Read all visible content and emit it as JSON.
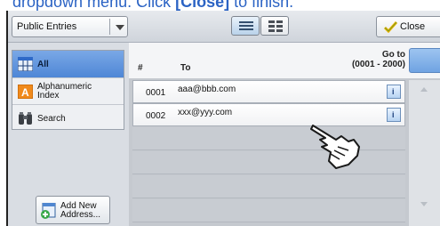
{
  "caption": {
    "prefix": "dropdown menu. Click ",
    "bold": "[Close]",
    "suffix": " to finish."
  },
  "toolbar": {
    "dropdown_value": "Public Entries",
    "close_label": "Close"
  },
  "sidebar": {
    "items": [
      {
        "label": "All",
        "active": true
      },
      {
        "label": "Alphanumeric\nIndex",
        "active": false
      },
      {
        "label": "Search",
        "active": false
      }
    ],
    "add_new_label": "Add New\nAddress..."
  },
  "list": {
    "col_num": "#",
    "col_to": "To",
    "goto_label": "Go to",
    "goto_range": "(0001 - 2000)",
    "rows": [
      {
        "num": "0001",
        "address": "aaa@bbb.com"
      },
      {
        "num": "0002",
        "address": "xxx@yyy.com"
      }
    ],
    "info_icon_text": "i"
  },
  "colors": {
    "caption": "#2b63c4",
    "active_nav": "#5b8fdb",
    "goto_box": "#7eb0e8"
  }
}
